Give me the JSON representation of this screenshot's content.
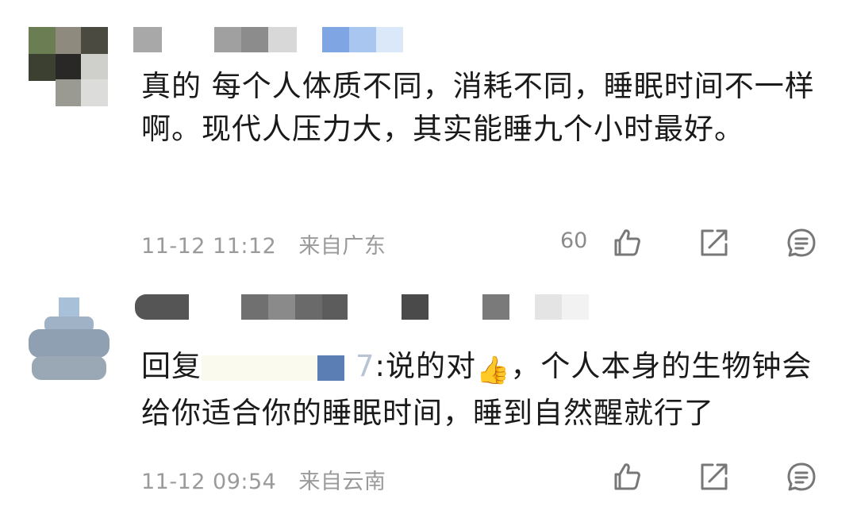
{
  "comments": [
    {
      "text": "真的 每个人体质不同，消耗不同，睡眠时间不一样啊。现代人压力大，其实能睡九个小时最好。",
      "date": "11-12 11:12",
      "location": "来自广东",
      "likes": "60",
      "icons": {
        "like": "thumbs-up-outline-icon",
        "share": "share-box-arrow-icon",
        "reply": "comment-bubble-icon"
      }
    },
    {
      "reply_prefix": "回复",
      "reply_tail": "7",
      "reply_body": ":说的对",
      "emoji": "👍",
      "text_rest": "，个人本身的生物钟会给你适合你的睡眠时间，睡到自然醒就行了",
      "date": "11-12 09:54",
      "location": "来自云南",
      "icons": {
        "like": "thumbs-up-outline-icon",
        "share": "share-box-arrow-icon",
        "reply": "comment-bubble-icon"
      }
    }
  ]
}
